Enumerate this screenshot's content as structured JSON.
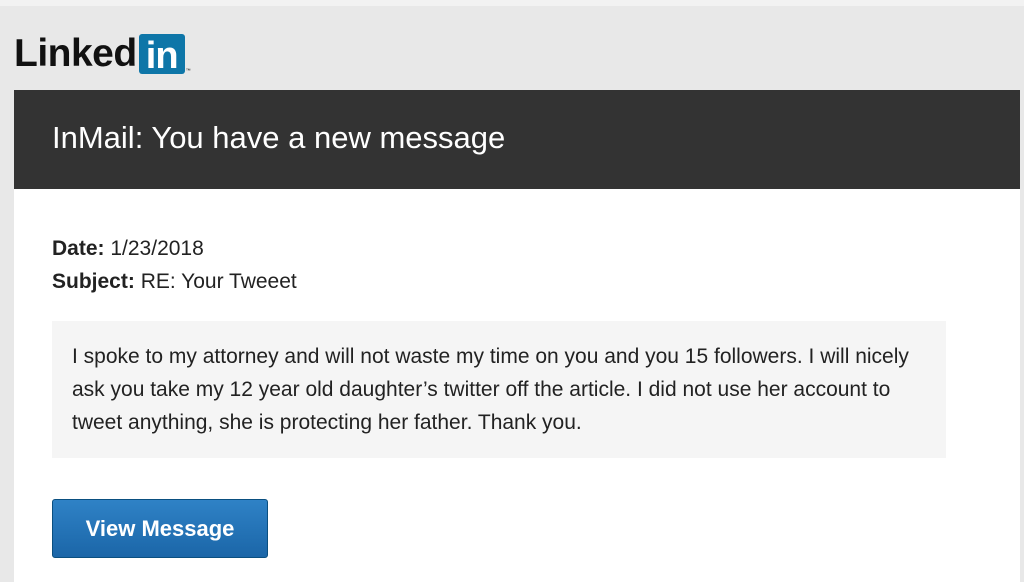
{
  "brand": {
    "logo_text": "Linked",
    "logo_badge": "in",
    "logo_tm": "™",
    "badge_color": "#0e76a8"
  },
  "header": {
    "title": "InMail: You have a new message",
    "background": "#333333"
  },
  "meta": {
    "date_label": "Date:",
    "date_value": "1/23/2018",
    "subject_label": "Subject:",
    "subject_value": "RE: Your Tweeet"
  },
  "message": {
    "body": "I spoke to my attorney and will not waste my time on you and you 15 followers. I will nicely ask you take my 12 year old daughter’s twitter off the article. I did not use her account to tweet anything, she is protecting her father. Thank you."
  },
  "actions": {
    "view_message_label": "View Message",
    "button_color": "#1b66a8"
  }
}
